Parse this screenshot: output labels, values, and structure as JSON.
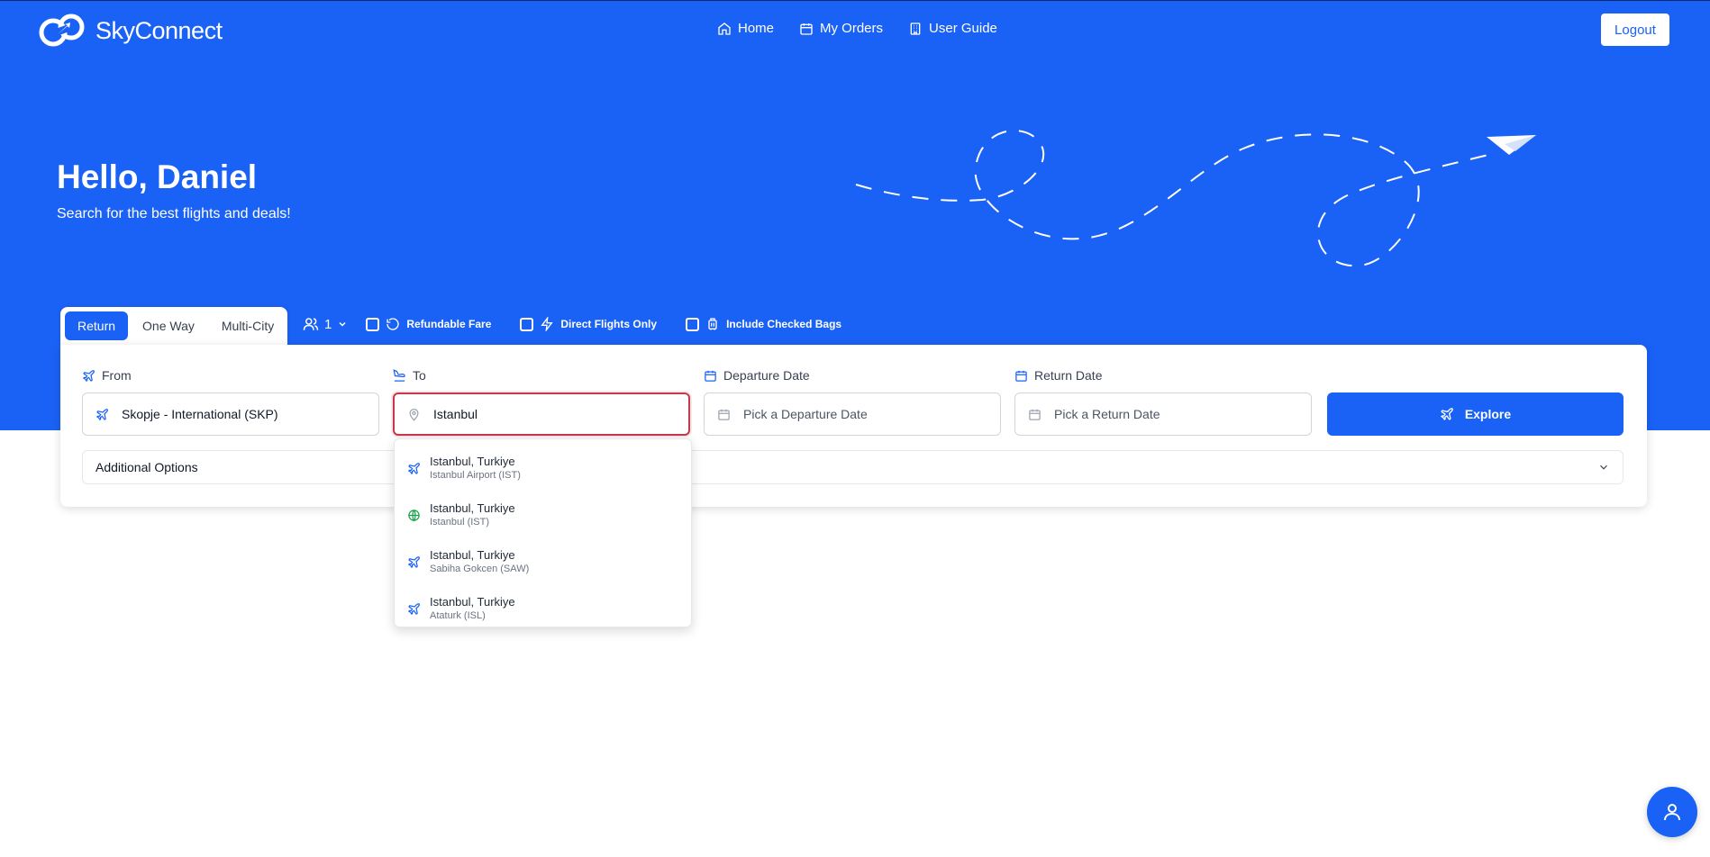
{
  "brand": {
    "name": "SkyConnect"
  },
  "nav": {
    "items": [
      {
        "label": "Home",
        "icon": "home-icon"
      },
      {
        "label": "My Orders",
        "icon": "calendar-icon"
      },
      {
        "label": "User Guide",
        "icon": "building-icon"
      }
    ],
    "logout_label": "Logout"
  },
  "hero": {
    "greeting": "Hello, Daniel",
    "subtitle": "Search for the best flights and deals!"
  },
  "trip_types": {
    "options": [
      "Return",
      "One Way",
      "Multi-City"
    ],
    "selected": "Return"
  },
  "passengers": {
    "count": "1"
  },
  "filters": {
    "refundable": {
      "label": "Refundable Fare",
      "checked": false
    },
    "direct": {
      "label": "Direct Flights Only",
      "checked": false
    },
    "bags": {
      "label": "Include Checked Bags",
      "checked": false
    }
  },
  "search": {
    "from": {
      "label": "From",
      "value": "Skopje - International (SKP)"
    },
    "to": {
      "label": "To",
      "value": "Istanbul"
    },
    "departure": {
      "label": "Departure Date",
      "placeholder": "Pick a Departure Date"
    },
    "return": {
      "label": "Return Date",
      "placeholder": "Pick a Return Date"
    },
    "explore_label": "Explore",
    "additional_options_label": "Additional Options"
  },
  "suggestions": [
    {
      "city": "Istanbul, Turkiye",
      "airport": "Istanbul Airport (IST)",
      "icon": "plane-icon"
    },
    {
      "city": "Istanbul, Turkiye",
      "airport": "Istanbul (IST)",
      "icon": "globe-icon"
    },
    {
      "city": "Istanbul, Turkiye",
      "airport": "Sabiha Gokcen (SAW)",
      "icon": "plane-icon"
    },
    {
      "city": "Istanbul, Turkiye",
      "airport": "Ataturk (ISL)",
      "icon": "plane-icon"
    }
  ],
  "colors": {
    "primary": "#1a61f5",
    "focus_border": "#c43a4a",
    "globe_green": "#16a34a"
  }
}
